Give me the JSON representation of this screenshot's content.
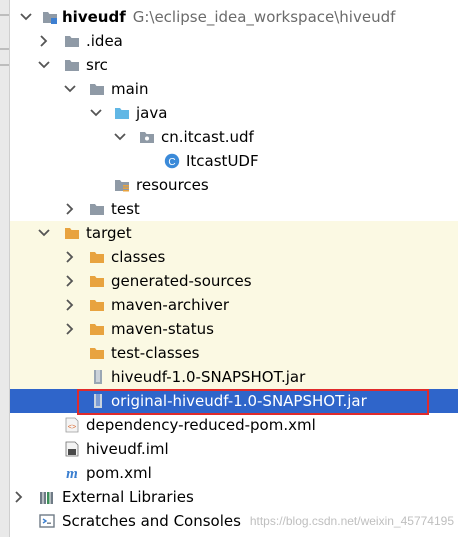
{
  "colors": {
    "folder": "#e8a33f",
    "folder_gray": "#8f9aa6",
    "source_folder": "#61b7e5",
    "excluded_bg": "#fbf9e3",
    "selection": "#2f65ca",
    "highlight_box": "#e02b2b"
  },
  "tree": {
    "root": {
      "name": "hiveudf",
      "path": "G:\\eclipse_idea_workspace\\hiveudf",
      "icon": "module-folder-icon"
    },
    "idea": {
      "name": ".idea",
      "icon": "folder-icon"
    },
    "src": {
      "name": "src",
      "icon": "folder-icon"
    },
    "main": {
      "name": "main",
      "icon": "folder-icon"
    },
    "java": {
      "name": "java",
      "icon": "source-folder-icon"
    },
    "package": {
      "name": "cn.itcast.udf",
      "icon": "package-icon"
    },
    "class": {
      "name": "ItcastUDF",
      "icon": "class-icon"
    },
    "resources": {
      "name": "resources",
      "icon": "resources-folder-icon"
    },
    "test": {
      "name": "test",
      "icon": "folder-icon"
    },
    "target": {
      "name": "target",
      "icon": "folder-icon"
    },
    "classes": {
      "name": "classes",
      "icon": "folder-icon"
    },
    "generated_sources": {
      "name": "generated-sources",
      "icon": "folder-icon"
    },
    "maven_archiver": {
      "name": "maven-archiver",
      "icon": "folder-icon"
    },
    "maven_status": {
      "name": "maven-status",
      "icon": "folder-icon"
    },
    "test_classes": {
      "name": "test-classes",
      "icon": "folder-icon"
    },
    "jar": {
      "name": "hiveudf-1.0-SNAPSHOT.jar",
      "icon": "jar-icon"
    },
    "original_jar": {
      "name": "original-hiveudf-1.0-SNAPSHOT.jar",
      "icon": "jar-icon"
    },
    "dependency_pom": {
      "name": "dependency-reduced-pom.xml",
      "icon": "xml-icon"
    },
    "iml": {
      "name": "hiveudf.iml",
      "icon": "iml-file-icon"
    },
    "pom": {
      "name": "pom.xml",
      "icon": "maven-icon"
    },
    "external_libraries": {
      "name": "External Libraries",
      "icon": "libraries-icon"
    },
    "scratches": {
      "name": "Scratches and Consoles",
      "icon": "scratches-icon"
    }
  },
  "class_badge": "C",
  "xml_badge": "<>",
  "maven_badge": "m",
  "watermark": "https://blog.csdn.net/weixin_45774195"
}
